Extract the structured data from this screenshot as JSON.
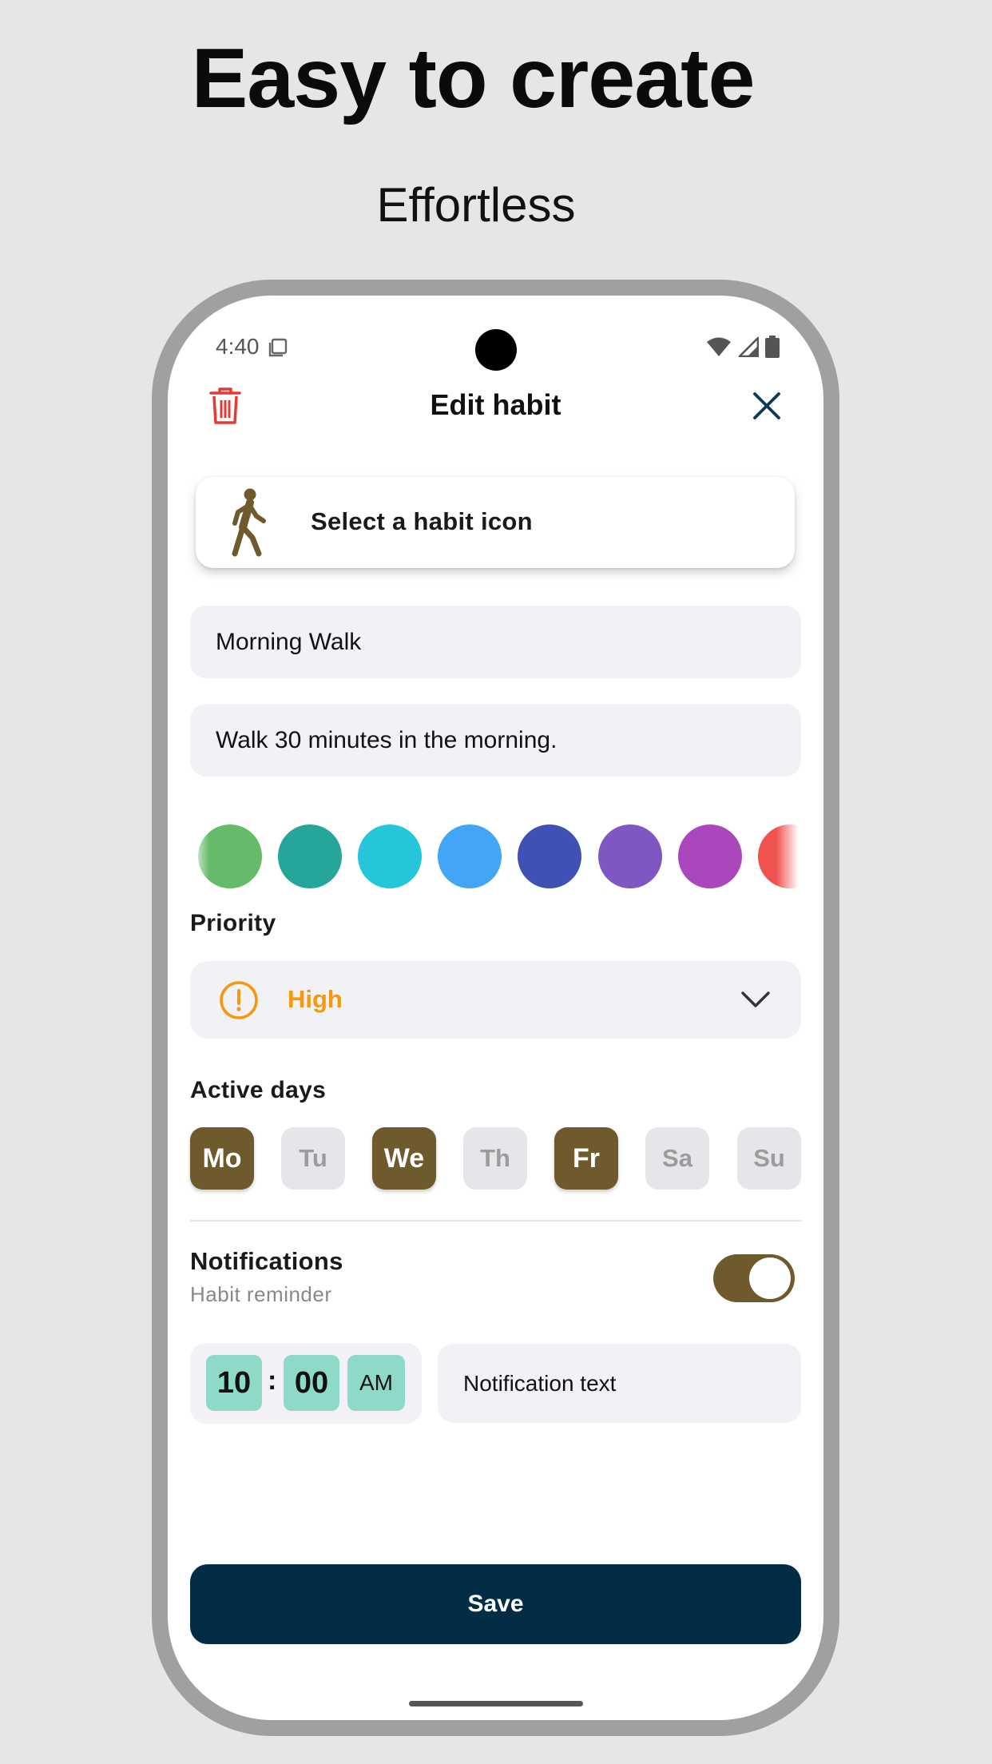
{
  "promo": {
    "headline": "Easy to create",
    "subheadline": "Effortless"
  },
  "status_bar": {
    "time": "4:40"
  },
  "top_bar": {
    "title": "Edit habit",
    "delete_icon": "trash-icon",
    "close_icon": "close-icon",
    "delete_color": "#e53935",
    "close_color": "#0d3a57"
  },
  "habit_icon": {
    "icon": "walking-person-icon",
    "label": "Select a habit icon",
    "icon_color": "#6e5a2c"
  },
  "form": {
    "name_value": "Morning Walk",
    "description_value": "Walk 30 minutes in the morning."
  },
  "color_palette": [
    "#66bb6a",
    "#26a69a",
    "#26c6da",
    "#42a5f5",
    "#3f51b5",
    "#7e57c2",
    "#ab47bc",
    "#ef5350"
  ],
  "priority": {
    "label": "Priority",
    "value": "High",
    "icon": "alert-circle-icon",
    "value_color": "#f5980d"
  },
  "active_days": {
    "label": "Active days",
    "days": [
      {
        "label": "Mo",
        "active": true
      },
      {
        "label": "Tu",
        "active": false
      },
      {
        "label": "We",
        "active": true
      },
      {
        "label": "Th",
        "active": false
      },
      {
        "label": "Fr",
        "active": true
      },
      {
        "label": "Sa",
        "active": false
      },
      {
        "label": "Su",
        "active": false
      }
    ]
  },
  "notifications": {
    "title": "Notifications",
    "subtitle": "Habit reminder",
    "enabled": true,
    "hour": "10",
    "minute": "00",
    "separator": ":",
    "period": "AM",
    "text_placeholder": "Notification text"
  },
  "actions": {
    "save_label": "Save"
  },
  "colors": {
    "accent": "#6e5a2c",
    "primary_button": "#032d44",
    "time_chip": "#8ed9c8"
  }
}
